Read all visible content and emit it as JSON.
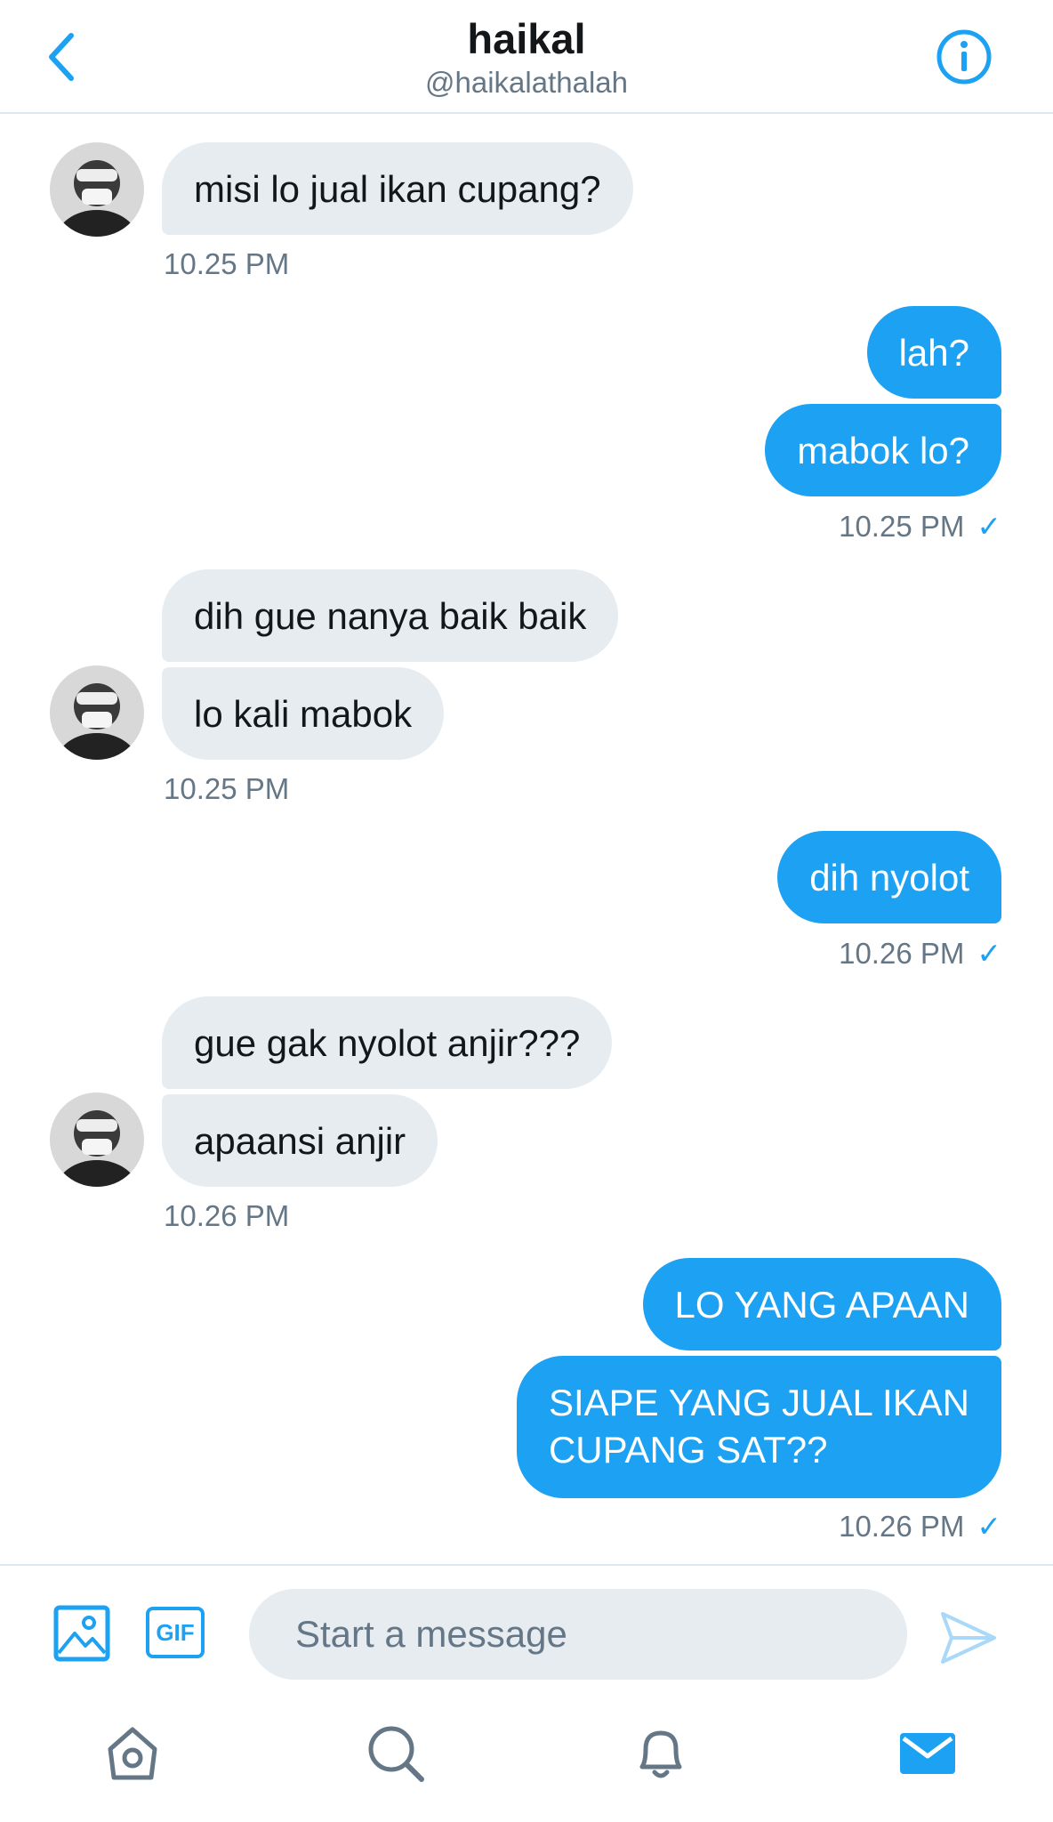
{
  "header": {
    "title": "haikal",
    "handle": "@haikalathalah"
  },
  "messages": [
    {
      "text": "misi lo jual ikan cupang?"
    },
    {
      "text": "lah?"
    },
    {
      "text": "mabok lo?"
    },
    {
      "text": "dih gue nanya baik baik"
    },
    {
      "text": "lo kali mabok"
    },
    {
      "text": "dih nyolot"
    },
    {
      "text": "gue gak nyolot anjir???"
    },
    {
      "text": "apaansi anjir"
    },
    {
      "text": "LO YANG APAAN"
    },
    {
      "text": "SIAPE YANG JUAL IKAN\nCUPANG SAT??"
    }
  ],
  "timestamps": [
    "10.25 PM",
    "10.25 PM",
    "10.25 PM",
    "10.26 PM",
    "10.26 PM",
    "10.26 PM"
  ],
  "read_mark": "✓",
  "composer": {
    "placeholder": "Start a message",
    "gif_label": "GIF"
  },
  "colors": {
    "accent": "#1da1f2",
    "incoming_bubble": "#e6ecf0",
    "secondary_text": "#657786"
  },
  "icons": [
    "back-icon",
    "info-icon",
    "image-icon",
    "gif-icon",
    "send-icon",
    "home-icon",
    "search-icon",
    "bell-icon",
    "mail-icon"
  ]
}
